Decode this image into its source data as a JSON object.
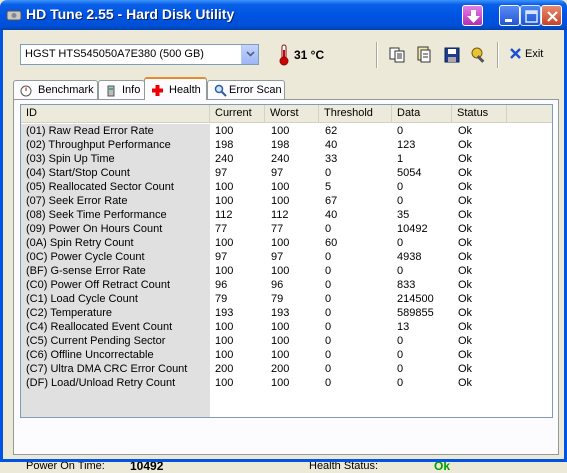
{
  "window": {
    "title": "HD Tune 2.55 - Hard Disk Utility"
  },
  "toolbar": {
    "drive": "HGST HTS545050A7E380 (500 GB)",
    "temperature": "31 °C",
    "exit_label": "Exit"
  },
  "tabs": [
    {
      "label": "Benchmark",
      "icon": "stopwatch-icon"
    },
    {
      "label": "Info",
      "icon": "info-icon"
    },
    {
      "label": "Health",
      "icon": "health-cross-icon",
      "active": true
    },
    {
      "label": "Error Scan",
      "icon": "magnifier-icon"
    }
  ],
  "table": {
    "columns": [
      "ID",
      "Current",
      "Worst",
      "Threshold",
      "Data",
      "Status"
    ],
    "rows": [
      [
        "(01) Raw Read Error Rate",
        "100",
        "100",
        "62",
        "0",
        "Ok"
      ],
      [
        "(02) Throughput Performance",
        "198",
        "198",
        "40",
        "123",
        "Ok"
      ],
      [
        "(03) Spin Up Time",
        "240",
        "240",
        "33",
        "1",
        "Ok"
      ],
      [
        "(04) Start/Stop Count",
        "97",
        "97",
        "0",
        "5054",
        "Ok"
      ],
      [
        "(05) Reallocated Sector Count",
        "100",
        "100",
        "5",
        "0",
        "Ok"
      ],
      [
        "(07) Seek Error Rate",
        "100",
        "100",
        "67",
        "0",
        "Ok"
      ],
      [
        "(08) Seek Time Performance",
        "112",
        "112",
        "40",
        "35",
        "Ok"
      ],
      [
        "(09) Power On Hours Count",
        "77",
        "77",
        "0",
        "10492",
        "Ok"
      ],
      [
        "(0A) Spin Retry Count",
        "100",
        "100",
        "60",
        "0",
        "Ok"
      ],
      [
        "(0C) Power Cycle Count",
        "97",
        "97",
        "0",
        "4938",
        "Ok"
      ],
      [
        "(BF) G-sense Error Rate",
        "100",
        "100",
        "0",
        "0",
        "Ok"
      ],
      [
        "(C0) Power Off Retract Count",
        "96",
        "96",
        "0",
        "833",
        "Ok"
      ],
      [
        "(C1) Load Cycle Count",
        "79",
        "79",
        "0",
        "214500",
        "Ok"
      ],
      [
        "(C2) Temperature",
        "193",
        "193",
        "0",
        "589855",
        "Ok"
      ],
      [
        "(C4) Reallocated Event Count",
        "100",
        "100",
        "0",
        "13",
        "Ok"
      ],
      [
        "(C5) Current Pending Sector",
        "100",
        "100",
        "0",
        "0",
        "Ok"
      ],
      [
        "(C6) Offline Uncorrectable",
        "100",
        "100",
        "0",
        "0",
        "Ok"
      ],
      [
        "(C7) Ultra DMA CRC Error Count",
        "200",
        "200",
        "0",
        "0",
        "Ok"
      ],
      [
        "(DF) Load/Unload Retry Count",
        "100",
        "100",
        "0",
        "0",
        "Ok"
      ]
    ]
  },
  "footer": {
    "power_on_label": "Power On Time:",
    "power_on_value": "10492",
    "health_label": "Health Status:",
    "health_value": "Ok"
  },
  "colors": {
    "title_bar": "#0054e3",
    "health_ok": "#00a000",
    "tab_accent": "#e68b2c"
  }
}
